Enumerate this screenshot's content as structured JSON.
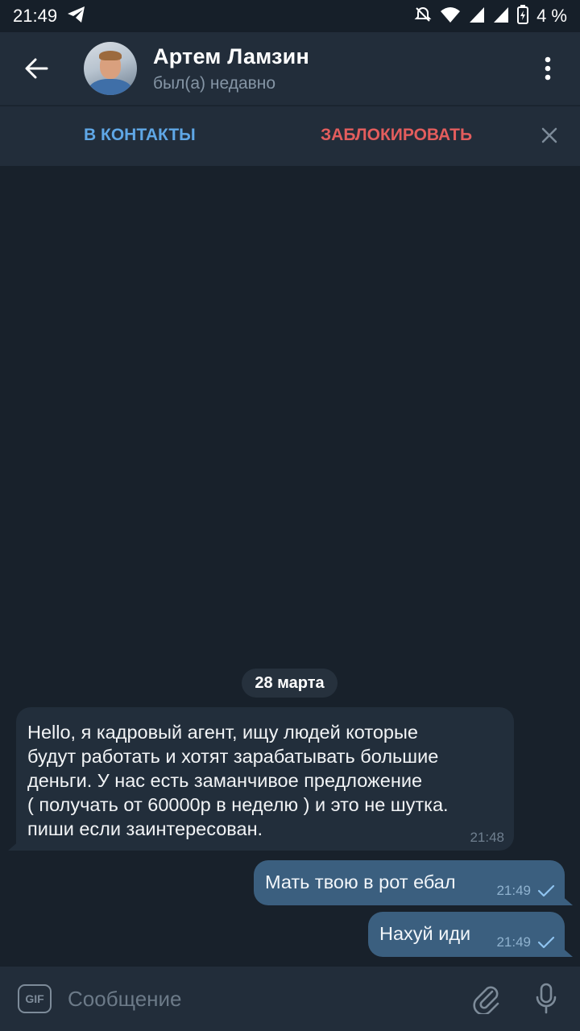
{
  "status_bar": {
    "time": "21:49",
    "battery": "4 %",
    "icons": [
      "telegram-icon",
      "mute-icon",
      "wifi-icon",
      "signal-icon",
      "signal-icon",
      "battery-icon"
    ]
  },
  "header": {
    "name": "Артем Ламзин",
    "status": "был(а) недавно"
  },
  "action_bar": {
    "add_contact": "В КОНТАКТЫ",
    "block": "ЗАБЛОКИРОВАТЬ"
  },
  "chat": {
    "date": "28 марта",
    "messages": [
      {
        "direction": "incoming",
        "text": "Hello, я кадровый агент, ищу людей которые\nбудут работать и хотят зарабатывать большие\nденьги.  У нас есть заманчивое предложение\n( получать от 60000р в неделю ) и это не шутка.\nпиши если заинтересован.",
        "time": "21:48"
      },
      {
        "direction": "outgoing",
        "text": "Мать твою в рот ебал",
        "time": "21:49",
        "status": "sent"
      },
      {
        "direction": "outgoing",
        "text": "Нахуй иди",
        "time": "21:49",
        "status": "sent"
      }
    ]
  },
  "input_bar": {
    "gif_label": "GIF",
    "placeholder": "Сообщение"
  },
  "colors": {
    "accent_blue": "#5fa7e6",
    "danger_red": "#e35d5d",
    "outgoing_bubble": "#3b5f7f",
    "incoming_bubble": "#222e3b"
  }
}
